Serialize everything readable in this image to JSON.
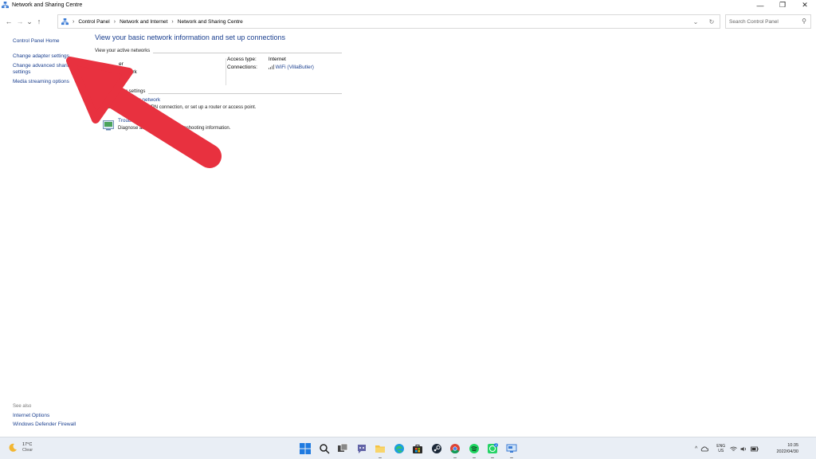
{
  "window": {
    "title": "Network and Sharing Centre",
    "minimize_glyph": "—",
    "maximize_glyph": "❐",
    "close_glyph": "✕"
  },
  "nav": {
    "back": "←",
    "forward": "→",
    "recent": "⌄",
    "up": "↑",
    "breadcrumbs": [
      "Control Panel",
      "Network and Internet",
      "Network and Sharing Centre"
    ],
    "separator": "›",
    "dropdown_glyph": "⌄",
    "refresh_glyph": "↻",
    "search_placeholder": "Search Control Panel",
    "search_glyph": "⚲"
  },
  "left_pane": {
    "home": "Control Panel Home",
    "items": [
      "Change adapter settings",
      "Change advanced sharing settings",
      "Media streaming options"
    ],
    "see_also_header": "See also",
    "see_also": [
      "Internet Options",
      "Windows Defender Firewall"
    ]
  },
  "main": {
    "title": "View your basic network information and set up connections",
    "active_networks_header": "View your active networks",
    "network_name": "er",
    "network_type": "network",
    "access_type_label": "Access type:",
    "access_type_value": "Internet",
    "connections_label": "Connections:",
    "connections_value": "WiFi (VillaButler)",
    "change_settings_header": "king settings",
    "settings": [
      {
        "link": "nection or network",
        "desc": "Set up l-up or VPN connection, or set up a router or access point."
      },
      {
        "link": "Troubleshoot p",
        "desc": "Diagnose and repai r get troubleshooting information."
      }
    ]
  },
  "taskbar": {
    "temperature": "17°C",
    "condition": "Clear",
    "apps": [
      "start-icon",
      "search-icon",
      "task-view-icon",
      "teams-chat-icon",
      "file-explorer-icon",
      "edge-icon",
      "store-icon",
      "steam-icon",
      "chrome-icon",
      "spotify-icon",
      "whatsapp-icon",
      "remote-desktop-icon"
    ],
    "lang_line1": "ENG",
    "lang_line2": "US",
    "time": "10:35",
    "date": "2022/04/30",
    "chevron": "^",
    "badge": "2"
  },
  "colors": {
    "link": "#1a3f8f",
    "arrow": "#e8313f",
    "taskbar": "#e9eef5"
  }
}
